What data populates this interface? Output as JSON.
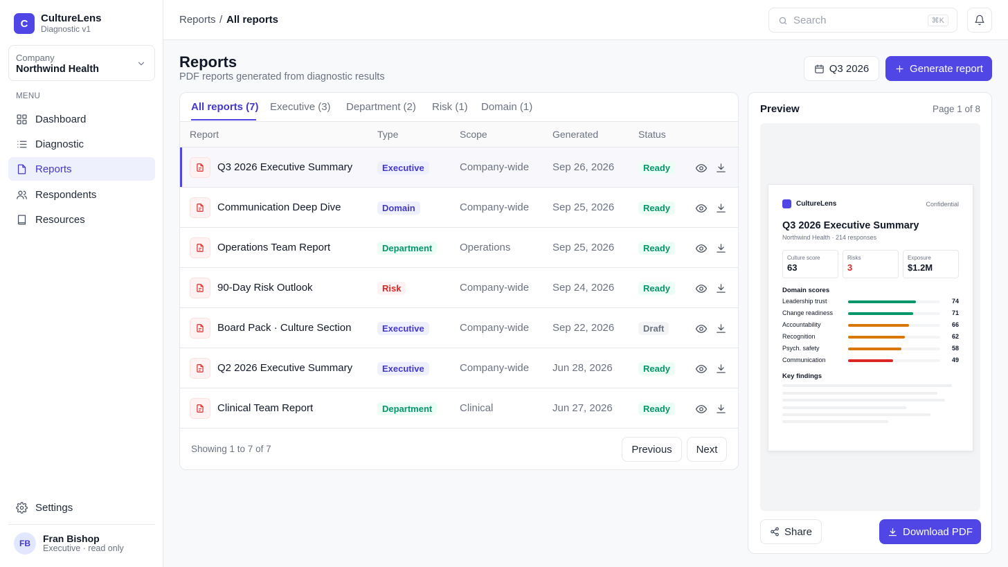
{
  "app": {
    "name": "CultureLens",
    "version": "Diagnostic v1",
    "logo_letter": "C",
    "accent": "#4f46e5"
  },
  "company": {
    "label": "Company",
    "name": "Northwind Health"
  },
  "menu": {
    "label": "MENU",
    "items": [
      {
        "label": "Dashboard",
        "icon": "grid-icon",
        "active": false
      },
      {
        "label": "Diagnostic",
        "icon": "list-icon",
        "active": false
      },
      {
        "label": "Reports",
        "icon": "file-icon",
        "active": true
      },
      {
        "label": "Respondents",
        "icon": "users-icon",
        "active": false
      },
      {
        "label": "Resources",
        "icon": "book-icon",
        "active": false
      }
    ],
    "settings": "Settings"
  },
  "user": {
    "initials": "FB",
    "name": "Fran Bishop",
    "role": "Executive · read only"
  },
  "topbar": {
    "breadcrumb": [
      "Reports",
      "All reports"
    ],
    "breadcrumb_sep": "/",
    "search_placeholder": "Search",
    "search_shortcut": "⌘K"
  },
  "header": {
    "title": "Reports",
    "subtitle": "PDF reports generated from diagnostic results",
    "period_button": "Q3 2026",
    "generate_button": "Generate report"
  },
  "tabs": [
    "All reports (7)",
    "Executive (3)",
    "Department (2)",
    "Risk (1)",
    "Domain (1)"
  ],
  "table": {
    "columns": [
      "Report",
      "Type",
      "Scope",
      "Generated",
      "Status"
    ],
    "rows": [
      {
        "name": "Q3 2026 Executive Summary",
        "type": "Executive",
        "scope": "Company-wide",
        "generated": "Sep 26, 2026",
        "status": "Ready",
        "selected": true
      },
      {
        "name": "Communication Deep Dive",
        "type": "Domain",
        "scope": "Company-wide",
        "generated": "Sep 25, 2026",
        "status": "Ready"
      },
      {
        "name": "Operations Team Report",
        "type": "Department",
        "scope": "Operations",
        "generated": "Sep 25, 2026",
        "status": "Ready"
      },
      {
        "name": "90-Day Risk Outlook",
        "type": "Risk",
        "scope": "Company-wide",
        "generated": "Sep 24, 2026",
        "status": "Ready"
      },
      {
        "name": "Board Pack · Culture Section",
        "type": "Executive",
        "scope": "Company-wide",
        "generated": "Sep 22, 2026",
        "status": "Draft"
      },
      {
        "name": "Q2 2026 Executive Summary",
        "type": "Executive",
        "scope": "Company-wide",
        "generated": "Jun 28, 2026",
        "status": "Ready"
      },
      {
        "name": "Clinical Team Report",
        "type": "Department",
        "scope": "Clinical",
        "generated": "Jun 27, 2026",
        "status": "Ready"
      }
    ],
    "footer": "Showing 1 to 7 of 7",
    "prev": "Previous",
    "next": "Next"
  },
  "preview": {
    "title": "Preview",
    "page": "Page 1 of 8",
    "share": "Share",
    "download": "Download PDF",
    "doc": {
      "brand": "CultureLens",
      "confidential": "Confidential",
      "title": "Q3 2026 Executive Summary",
      "subtitle": "Northwind Health · 214 responses",
      "kpis": [
        {
          "label": "Culture score",
          "value": "63",
          "color": "#111827"
        },
        {
          "label": "Risks",
          "value": "3",
          "color": "#dc2626"
        },
        {
          "label": "Exposure",
          "value": "$1.2M",
          "color": "#111827"
        }
      ],
      "domain_heading": "Domain scores",
      "domains": [
        {
          "label": "Leadership trust",
          "value": 74,
          "color": "#059669"
        },
        {
          "label": "Change readiness",
          "value": 71,
          "color": "#059669"
        },
        {
          "label": "Accountability",
          "value": 66,
          "color": "#d97706"
        },
        {
          "label": "Recognition",
          "value": 62,
          "color": "#d97706"
        },
        {
          "label": "Psych. safety",
          "value": 58,
          "color": "#d97706"
        },
        {
          "label": "Communication",
          "value": 49,
          "color": "#dc2626"
        }
      ],
      "findings_heading": "Key findings"
    }
  }
}
